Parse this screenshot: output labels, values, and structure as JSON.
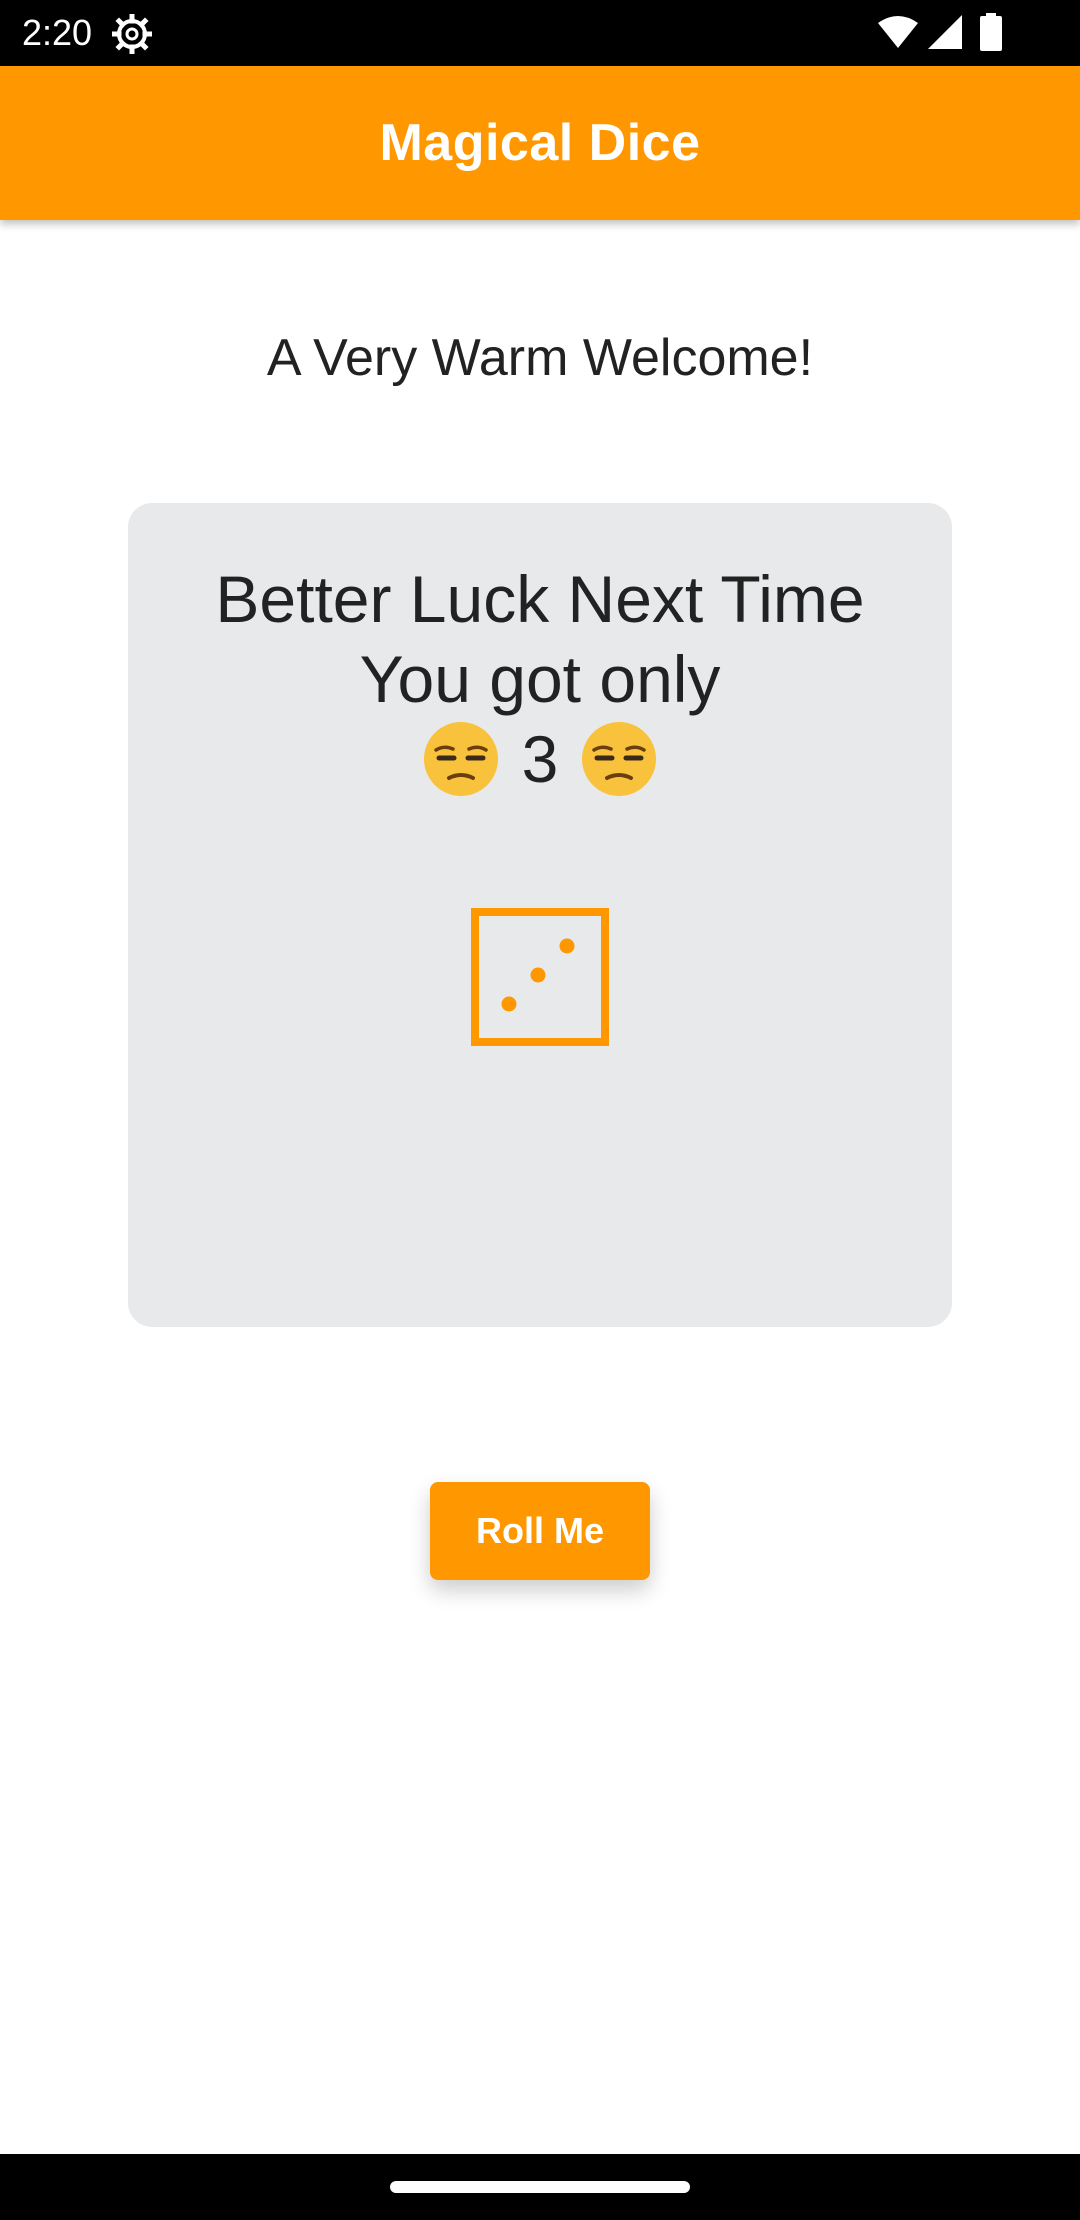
{
  "status_bar": {
    "time": "2:20",
    "icons": [
      "gear-icon",
      "wifi-icon",
      "signal-icon",
      "battery-icon"
    ]
  },
  "app_bar": {
    "title": "Magical Dice",
    "color": "#ff9800"
  },
  "main": {
    "welcome": "A Very Warm Welcome!",
    "card": {
      "line1": "Better Luck Next Time",
      "line2": "You got only",
      "number": "3",
      "emoji": "unamused-face-icon",
      "dice_icon": "dice-three-icon"
    },
    "roll_button_label": "Roll Me"
  },
  "colors": {
    "accent": "#ff9800",
    "card_background": "#e8e9eb",
    "text": "#222222"
  }
}
